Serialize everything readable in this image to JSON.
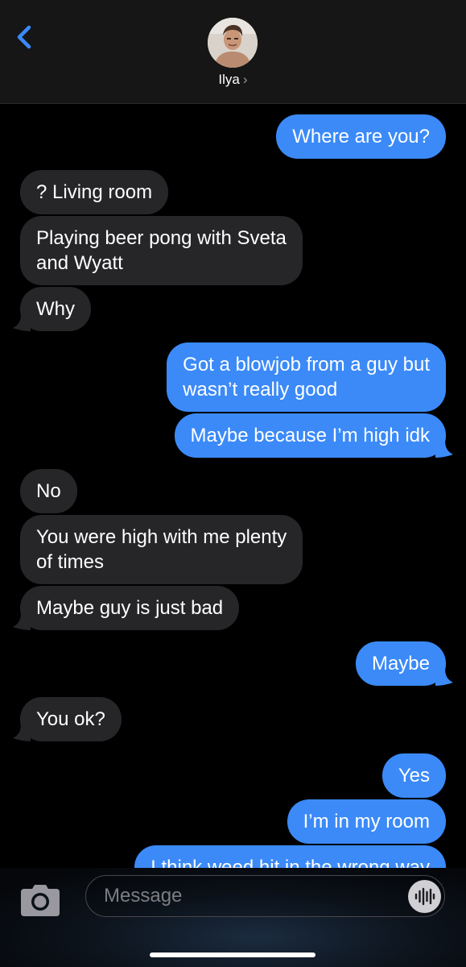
{
  "header": {
    "contact_name": "Ilya",
    "chevron": "›",
    "back_icon": "chevron-left-icon",
    "accent_color": "#3b8af8"
  },
  "messages": [
    {
      "side": "out",
      "text": "Where are you?"
    },
    {
      "side": "in",
      "text": "? Living room"
    },
    {
      "side": "in",
      "text": "Playing beer pong with Sveta\nand Wyatt"
    },
    {
      "side": "in",
      "text": "Why"
    },
    {
      "side": "out",
      "text": "Got a blowjob from a guy but\nwasn’t really good"
    },
    {
      "side": "out",
      "text": "Maybe because I’m high idk"
    },
    {
      "side": "in",
      "text": "No"
    },
    {
      "side": "in",
      "text": "You were high with me plenty\nof times"
    },
    {
      "side": "in",
      "text": "Maybe guy is just bad"
    },
    {
      "side": "out",
      "text": "Maybe"
    },
    {
      "side": "in",
      "text": "You ok?"
    },
    {
      "side": "out",
      "text": "Yes"
    },
    {
      "side": "out",
      "text": "I’m in my room"
    },
    {
      "side": "out",
      "text": "I think weed hit in the wrong way"
    }
  ],
  "composer": {
    "placeholder": "Message",
    "camera_icon": "camera-icon",
    "audio_icon": "audio-waveform-icon"
  },
  "colors": {
    "incoming_bubble": "#262629",
    "outgoing_bubble": "#3b8af8",
    "background": "#000000"
  }
}
